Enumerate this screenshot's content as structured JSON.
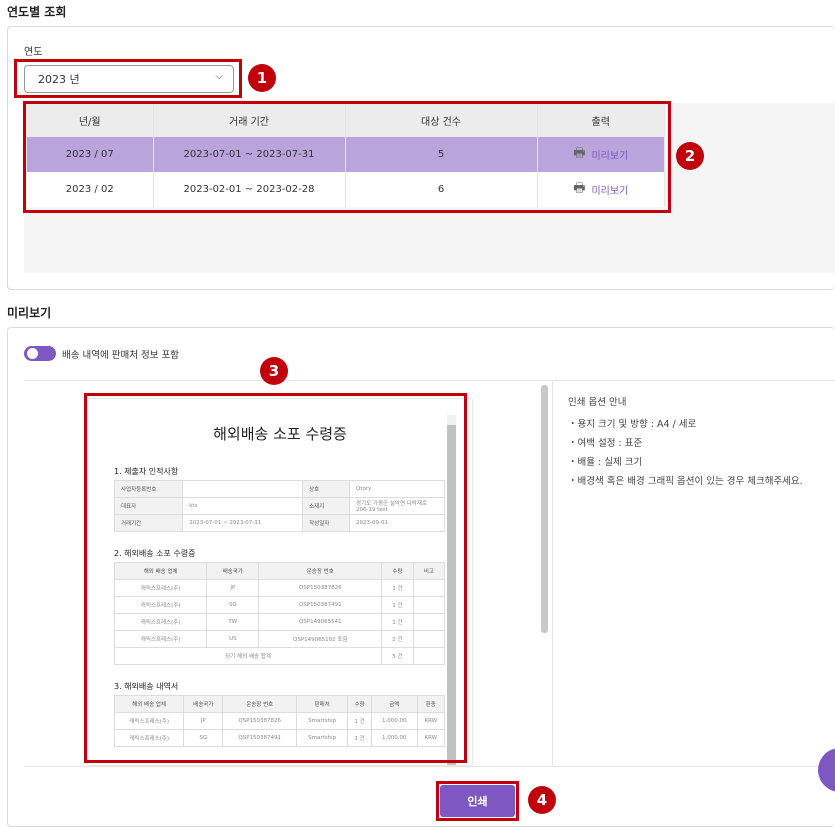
{
  "yearly": {
    "title": "연도별 조회",
    "year_label": "연도",
    "year_value": "2023 년",
    "columns": [
      "년/월",
      "거래 기간",
      "대상 건수",
      "출력"
    ],
    "rows": [
      {
        "month": "2023 / 07",
        "period": "2023-07-01 ~ 2023-07-31",
        "count": "5",
        "action": "미리보기",
        "selected": true
      },
      {
        "month": "2023 / 02",
        "period": "2023-02-01 ~ 2023-02-28",
        "count": "6",
        "action": "미리보기",
        "selected": false
      }
    ]
  },
  "preview": {
    "title": "미리보기",
    "toggle_label": "배송 내역에 판매처 정보 포함",
    "toggle_on": true,
    "doc": {
      "title": "해외배송 소포 수령증",
      "s1": {
        "title": "1. 제출자 인적사항",
        "rows": [
          [
            "사업자등록번호",
            "",
            "상호",
            "Qtory"
          ],
          [
            "대표자",
            "kts",
            "소재지",
            "경기도 가평군 설악면 다락재로 206-19 test"
          ],
          [
            "거래기간",
            "2023-07-01 ~ 2023-07-31",
            "작성일자",
            "2023-09-01"
          ]
        ]
      },
      "s2": {
        "title": "2. 해외배송 소포 수령증",
        "columns": [
          "해외 배송 업체",
          "배송국가",
          "운송장 번호",
          "수량",
          "비고"
        ],
        "rows": [
          [
            "캐릭스프레스(주)",
            "JP",
            "QSP150387826",
            "1 건",
            ""
          ],
          [
            "캐릭스프레스(주)",
            "SG",
            "QSP150387491",
            "1 건",
            ""
          ],
          [
            "캐릭스프레스(주)",
            "TW",
            "QSP149065541",
            "1 건",
            ""
          ],
          [
            "캐릭스프레스(주)",
            "US",
            "QSP149065102 포함",
            "2 건",
            ""
          ]
        ],
        "total_label": "당기 해외 배송 합계",
        "total": "5 건"
      },
      "s3": {
        "title": "3. 해외배송 내역서",
        "columns": [
          "해외 배송 업체",
          "배송국가",
          "운송장 번호",
          "판매처",
          "수량",
          "금액",
          "환종"
        ],
        "rows": [
          [
            "캐릭스프레스(주)",
            "JP",
            "QSP150387826",
            "Smartship",
            "1 건",
            "1,000.00",
            "KRW"
          ],
          [
            "캐릭스프레스(주)",
            "SG",
            "QSP150387491",
            "Smartship",
            "1 건",
            "1,000.00",
            "KRW"
          ]
        ]
      }
    },
    "print_info": {
      "title": "인쇄 옵션 안내",
      "items": [
        "・용지 크기 및 방향 : A4 / 세로",
        "・여백 설정 : 표준",
        "・배율 : 실제 크기",
        "・배경색 혹은 배경 그래픽 옵션이 있는 경우 체크해주세요."
      ]
    },
    "print_button": "인쇄"
  },
  "badges": [
    "1",
    "2",
    "3",
    "4"
  ],
  "colors": {
    "accent": "#7e57c2",
    "selected_row": "#b9a5dc",
    "annotation": "#c0000b"
  }
}
